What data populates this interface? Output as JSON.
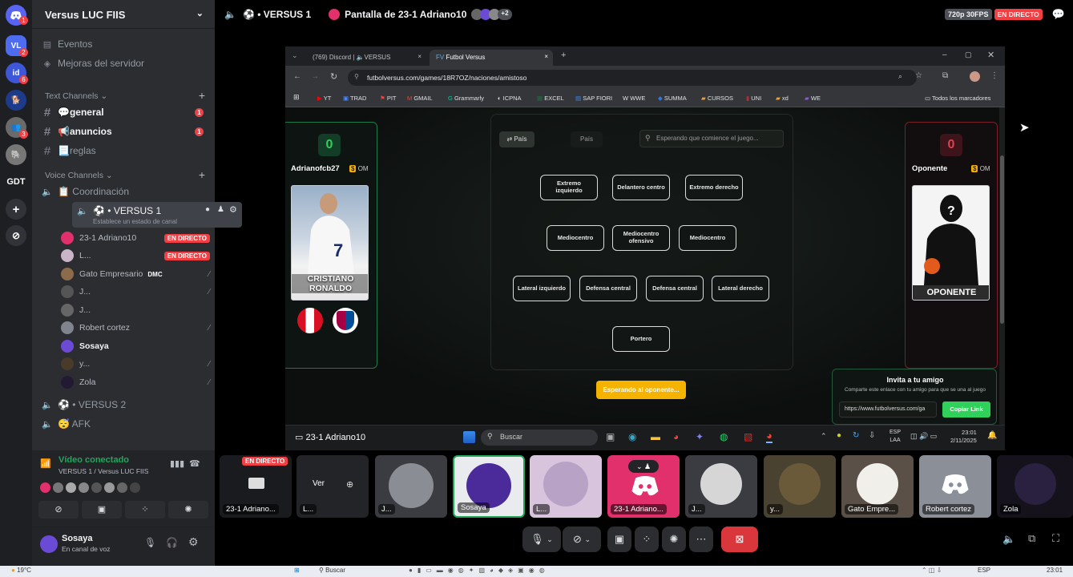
{
  "rail": {
    "badges": [
      "1",
      "2",
      "6",
      "3"
    ],
    "label_gdt": "GDT"
  },
  "sidebar": {
    "server_name": "Versus LUC FIIS",
    "events": "Eventos",
    "boost": "Mejoras del servidor",
    "text_category": "Text Channels",
    "text_channels": [
      {
        "name": "💬general",
        "badge": "1"
      },
      {
        "name": "📢anuncios",
        "badge": "1"
      },
      {
        "name": "📃reglas",
        "badge": ""
      }
    ],
    "voice_category": "Voice Channels",
    "voice_channels": [
      {
        "name": "📋 Coordinación"
      },
      {
        "name": "VERSUS 1",
        "status": "Establece un estado de canal"
      },
      {
        "name": "VERSUS 2"
      },
      {
        "name": "AFK"
      }
    ],
    "voice_users": [
      {
        "name": "23-1 Adriano10",
        "live": "EN DIRECTO"
      },
      {
        "name": "L...",
        "live": "EN DIRECTO"
      },
      {
        "name": "Gato Empresario",
        "tag": "DMC"
      },
      {
        "name": "J..."
      },
      {
        "name": "J..."
      },
      {
        "name": "Robert cortez"
      },
      {
        "name": "Sosaya"
      },
      {
        "name": "y..."
      },
      {
        "name": "Zola"
      }
    ],
    "voice_panel": {
      "status": "Vídeo conectado",
      "channel": "VERSUS 1 / Versus LUC FIIS"
    },
    "user": {
      "name": "Sosaya",
      "status": "En canal de voz"
    }
  },
  "topbar": {
    "channel": "VERSUS 1",
    "stream_title": "Pantalla de 23-1 Adriano10",
    "extra_count": "+2",
    "quality": "720p 30FPS",
    "live": "EN DIRECTO"
  },
  "browser": {
    "tab1": "(769) Discord | 🔈VERSUS",
    "tab2": "Futbol Versus",
    "url": "futbolversus.com/games/18R7OZ/naciones/amistoso",
    "bookmarks": [
      "YT",
      "TRAD",
      "PIT",
      "GMAIL",
      "Grammarly",
      "ICPNA",
      "EXCEL",
      "SAP FIORI",
      "WWE",
      "SUMMA",
      "CURSOS",
      "UNI",
      "xd",
      "WE"
    ],
    "all_bookmarks": "Todos los marcadores"
  },
  "game": {
    "left_score": "0",
    "left_player": "Adrianofcb27",
    "left_om": "OM",
    "card_name_1": "CRISTIANO",
    "card_name_2": "RONALDO",
    "right_score": "0",
    "right_player": "Oponente",
    "right_om": "OM",
    "right_card": "OPONENTE",
    "tab_pais": "País",
    "tab_pais2": "País",
    "search": "Esperando que comience el juego...",
    "positions": {
      "ei": "Extremo izquierdo",
      "dc": "Delantero centro",
      "ed": "Extremo derecho",
      "mc1": "Mediocentro",
      "mco": "Mediocentro ofensivo",
      "mc2": "Mediocentro",
      "li": "Lateral izquierdo",
      "dfc1": "Defensa central",
      "dfc2": "Defensa central",
      "ld": "Lateral derecho",
      "por": "Portero"
    },
    "waiting": "Esperando al oponente...",
    "invite_title": "Invita a tu amigo",
    "invite_text": "Comparte este enlace con tu amigo para que se una al juego",
    "invite_link": "https://www.futbolversus.com/ga",
    "copy": "Copiar Link"
  },
  "inner_taskbar": {
    "stream_user": "23-1 Adriano10",
    "search": "Buscar",
    "lang": "ESP",
    "lang2": "LAA",
    "time": "23:01",
    "date": "2/11/2025"
  },
  "tiles": [
    {
      "label": "23-1 Adriano...",
      "badge": "EN DIRECTO"
    },
    {
      "label": "L...",
      "extra": "Ver"
    },
    {
      "label": "J..."
    },
    {
      "label": "Sosaya"
    },
    {
      "label": "L..."
    },
    {
      "label": "23-1 Adriano..."
    },
    {
      "label": "J..."
    },
    {
      "label": "y..."
    },
    {
      "label": "Gato Empre..."
    },
    {
      "label": "Robert cortez"
    },
    {
      "label": "Zola"
    }
  ],
  "os": {
    "temp": "19°C",
    "search": "Buscar",
    "lang": "ESP",
    "time": "23:01"
  },
  "colors": {
    "live": "#f23f43",
    "accent": "#5865f2",
    "connected": "#23a55a",
    "yellow": "#f5b300",
    "green_btn": "#2fd15a"
  }
}
